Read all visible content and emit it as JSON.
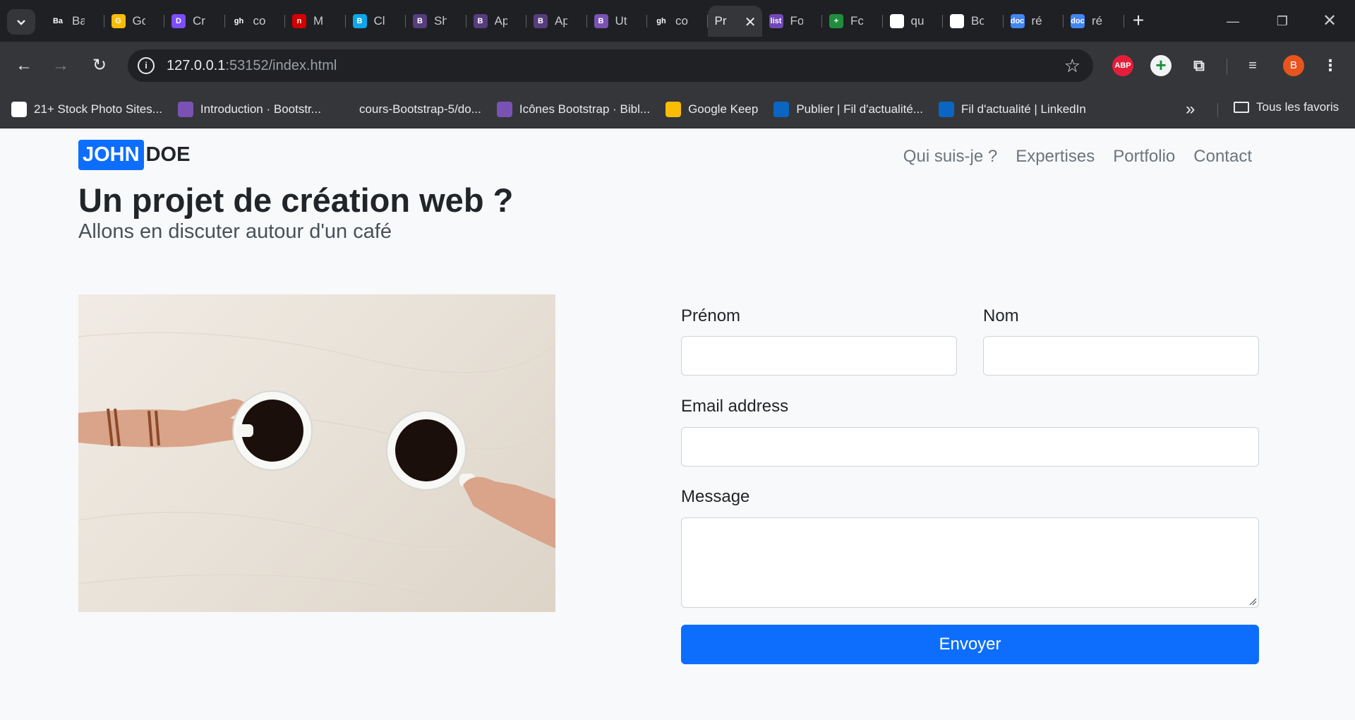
{
  "browser": {
    "tabs": [
      {
        "favicon": "Ba",
        "title": "Ba",
        "color": "#1f2023"
      },
      {
        "favicon": "G",
        "title": "Gc",
        "color": "#fbbc04"
      },
      {
        "favicon": "D",
        "title": "Cr",
        "color": "#7c4dff"
      },
      {
        "favicon": "gh",
        "title": "co",
        "color": "#1f2023"
      },
      {
        "favicon": "n",
        "title": "M",
        "color": "#d40000"
      },
      {
        "favicon": "B",
        "title": "Cl",
        "color": "#0ea5e9"
      },
      {
        "favicon": "B",
        "title": "Sh",
        "color": "#563d7c"
      },
      {
        "favicon": "B",
        "title": "Ap",
        "color": "#563d7c"
      },
      {
        "favicon": "B",
        "title": "Ap",
        "color": "#563d7c"
      },
      {
        "favicon": "B",
        "title": "Ut",
        "color": "#7952b3"
      },
      {
        "favicon": "gh",
        "title": "co",
        "color": "#1f2023"
      },
      {
        "favicon": "",
        "title": "Pr",
        "active": true
      },
      {
        "favicon": "list",
        "title": "Fo",
        "color": "#7248b9"
      },
      {
        "favicon": "+",
        "title": "Fc",
        "color": "#1e8e3e"
      },
      {
        "favicon": "G",
        "title": "qu",
        "color": "#ffffff"
      },
      {
        "favicon": "M",
        "title": "Bo",
        "color": "#ffffff"
      },
      {
        "favicon": "doc",
        "title": "ré",
        "color": "#4285f4"
      },
      {
        "favicon": "doc",
        "title": "ré",
        "color": "#4285f4"
      }
    ],
    "url_host": "127.0.0.1",
    "url_rest": ":53152/index.html",
    "avatar_letter": "B",
    "abp_label": "ABP",
    "bookmarks": [
      {
        "icon": "google-icon",
        "label": "21+ Stock Photo Sites..."
      },
      {
        "icon": "bootstrap-icon",
        "label": "Introduction · Bootstr..."
      },
      {
        "icon": "github-icon",
        "label": "cours-Bootstrap-5/do..."
      },
      {
        "icon": "bootstrap-icon",
        "label": "Icônes Bootstrap · Bibl..."
      },
      {
        "icon": "keep-icon",
        "label": "Google Keep"
      },
      {
        "icon": "linkedin-icon",
        "label": "Publier | Fil d'actualité..."
      },
      {
        "icon": "linkedin-icon",
        "label": "Fil d'actualité | LinkedIn"
      }
    ],
    "all_bookmarks": "Tous les favoris"
  },
  "site": {
    "brand_first": "JOHN",
    "brand_last": "DOE",
    "nav": [
      "Qui suis-je ?",
      "Expertises",
      "Portfolio",
      "Contact"
    ],
    "title": "Un projet de création web ?",
    "subtitle": "Allons en discuter autour d'un café"
  },
  "form": {
    "first_name_label": "Prénom",
    "first_name_value": "",
    "last_name_label": "Nom",
    "last_name_value": "",
    "email_label": "Email address",
    "email_value": "",
    "message_label": "Message",
    "message_value": "",
    "submit_label": "Envoyer"
  },
  "colors": {
    "accent": "#0d6efd",
    "chrome_dark": "#1f2023",
    "chrome_toolbar": "#35363a"
  }
}
